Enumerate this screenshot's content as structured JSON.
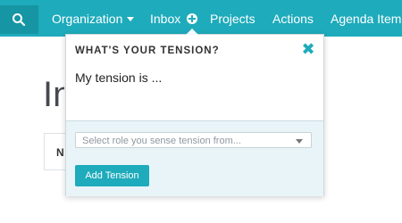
{
  "topbar": {
    "nav": {
      "organization": "Organization",
      "inbox": "Inbox",
      "projects": "Projects",
      "actions": "Actions",
      "agenda": "Agenda Item"
    }
  },
  "background": {
    "page_title": "Inbox",
    "box_label": "N"
  },
  "popover": {
    "title": "WHAT'S YOUR TENSION?",
    "tension_text": "My tension is ...",
    "role_placeholder": "Select role you sense tension from...",
    "add_button": "Add Tension"
  },
  "colors": {
    "accent": "#1eabbb",
    "footer_bg": "#e8f4f8"
  },
  "icons": {
    "search": "search-icon",
    "plus": "plus-circle-icon",
    "close": "close-icon"
  }
}
